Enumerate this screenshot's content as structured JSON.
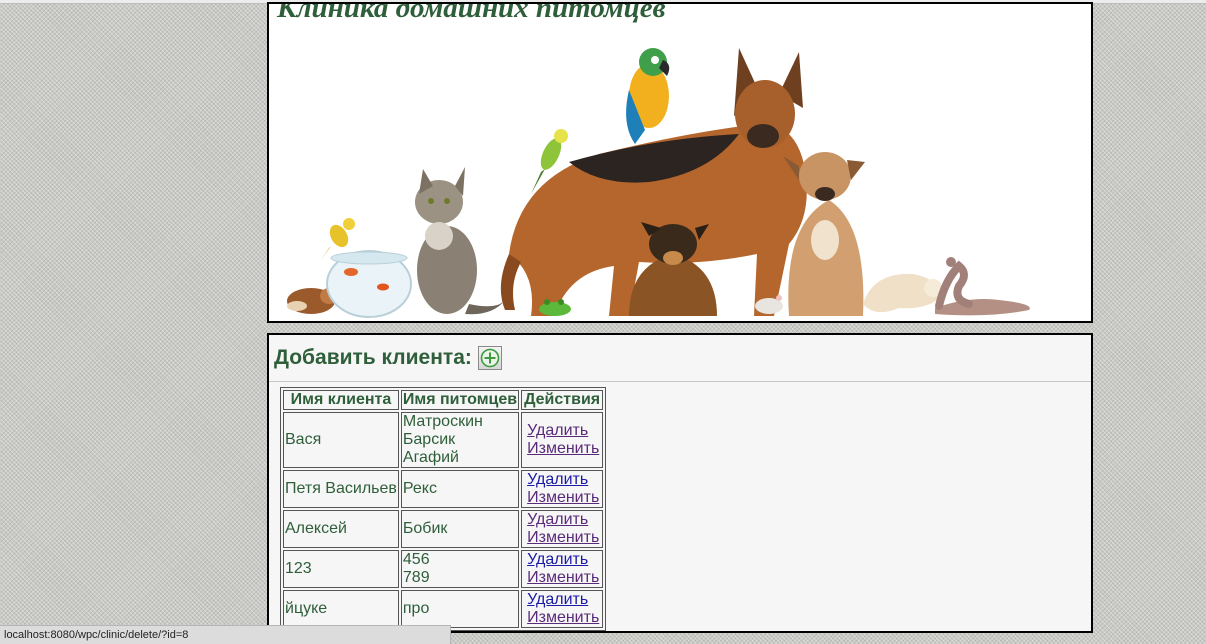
{
  "header": {
    "site_title": "Клиника домашних питомцев"
  },
  "add_section": {
    "label": "Добавить клиента:",
    "add_icon": "plus-circle-icon"
  },
  "table": {
    "columns": [
      "Имя клиента",
      "Имя питомцев",
      "Действия"
    ],
    "rows": [
      {
        "client": "Вася",
        "pets": [
          "Матроскин",
          "Барсик",
          "Агафий"
        ],
        "delete": "Удалить",
        "edit": "Изменить"
      },
      {
        "client": "Петя Васильев",
        "pets": [
          "Рекс"
        ],
        "delete": "Удалить",
        "edit": "Изменить"
      },
      {
        "client": "Алексей",
        "pets": [
          "Бобик"
        ],
        "delete": "Удалить",
        "edit": "Изменить"
      },
      {
        "client": "123",
        "pets": [
          "456",
          "789"
        ],
        "delete": "Удалить",
        "edit": "Изменить"
      },
      {
        "client": "йцуке",
        "pets": [
          "про"
        ],
        "delete": "Удалить",
        "edit": "Изменить"
      }
    ]
  },
  "status_bar": {
    "url": "localhost:8080/wpc/clinic/delete/?id=8"
  },
  "colors": {
    "title_green": "#2f5e3a",
    "link_blue": "#1a1aa6",
    "link_visited": "#5a2a7a"
  }
}
